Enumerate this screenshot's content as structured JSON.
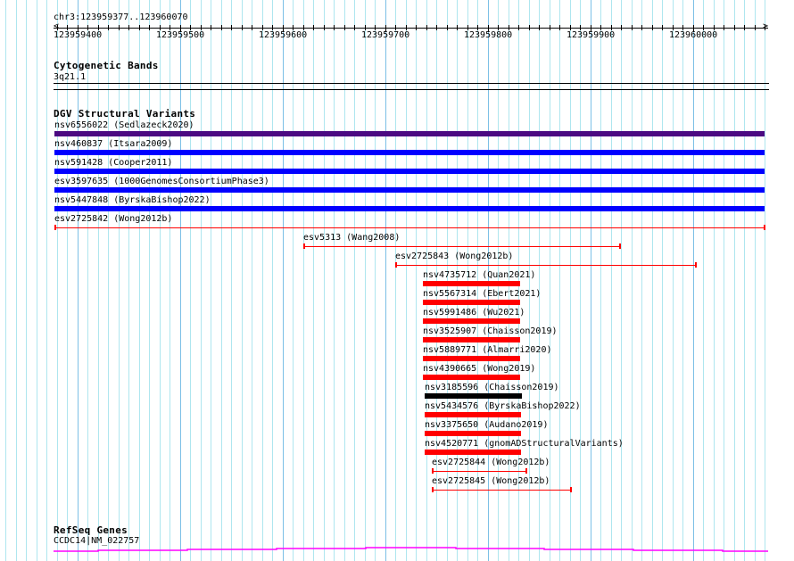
{
  "ruler": {
    "location": "chr3:123959377..123960070",
    "start": 123959377,
    "end": 123960070,
    "tick_labels": [
      "123959400",
      "123959500",
      "123959600",
      "123959700",
      "123959800",
      "123959900",
      "123960000"
    ]
  },
  "cytoband": {
    "title": "Cytogenetic Bands",
    "band": "3q21.1"
  },
  "dgv": {
    "title": "DGV Structural Variants",
    "features": [
      {
        "label": "nsv6556022 (Sedlazeck2020)",
        "start": 123959377,
        "end": 123960070,
        "style": "thick",
        "color": "#4b0a82"
      },
      {
        "label": "nsv460837 (Itsara2009)",
        "start": 123959377,
        "end": 123960070,
        "style": "thick",
        "color": "#0000ff"
      },
      {
        "label": "nsv591428 (Cooper2011)",
        "start": 123959377,
        "end": 123960070,
        "style": "thick",
        "color": "#0000ff"
      },
      {
        "label": "esv3597635 (1000GenomesConsortiumPhase3)",
        "start": 123959377,
        "end": 123960070,
        "style": "thick",
        "color": "#0000ff"
      },
      {
        "label": "nsv5447848 (ByrskaBishop2022)",
        "start": 123959377,
        "end": 123960070,
        "style": "thick",
        "color": "#0000ff"
      },
      {
        "label": "esv2725842 (Wong2012b)",
        "start": 123959377,
        "end": 123960070,
        "style": "line",
        "color": "#ff0000"
      },
      {
        "label": "esv5313 (Wang2008)",
        "start": 123959620,
        "end": 123959929,
        "style": "line",
        "color": "#ff0000"
      },
      {
        "label": "esv2725843 (Wong2012b)",
        "start": 123959710,
        "end": 123960003,
        "style": "line",
        "color": "#ff0000"
      },
      {
        "label": "nsv4735712 (Quan2021)",
        "start": 123959737,
        "end": 123959831,
        "style": "thick",
        "color": "#ff0000"
      },
      {
        "label": "nsv5567314 (Ebert2021)",
        "start": 123959737,
        "end": 123959831,
        "style": "thick",
        "color": "#ff0000"
      },
      {
        "label": "nsv5991486 (Wu2021)",
        "start": 123959737,
        "end": 123959831,
        "style": "thick",
        "color": "#ff0000"
      },
      {
        "label": "nsv3525907 (Chaisson2019)",
        "start": 123959737,
        "end": 123959831,
        "style": "thick",
        "color": "#ff0000"
      },
      {
        "label": "nsv5889771 (Almarri2020)",
        "start": 123959737,
        "end": 123959831,
        "style": "thick",
        "color": "#ff0000"
      },
      {
        "label": "nsv4390665 (Wong2019)",
        "start": 123959737,
        "end": 123959831,
        "style": "thick",
        "color": "#ff0000"
      },
      {
        "label": "nsv3185596 (Chaisson2019)",
        "start": 123959738,
        "end": 123959833,
        "style": "thick",
        "color": "#000000"
      },
      {
        "label": "nsv5434576 (ByrskaBishop2022)",
        "start": 123959738,
        "end": 123959832,
        "style": "thick",
        "color": "#ff0000"
      },
      {
        "label": "nsv3375650 (Audano2019)",
        "start": 123959738,
        "end": 123959832,
        "style": "thick",
        "color": "#ff0000"
      },
      {
        "label": "nsv4520771 (gnomADStructuralVariants)",
        "start": 123959738,
        "end": 123959832,
        "style": "thick",
        "color": "#ff0000"
      },
      {
        "label": "esv2725844 (Wong2012b)",
        "start": 123959745,
        "end": 123959837,
        "style": "line",
        "color": "#ff0000"
      },
      {
        "label": "esv2725845 (Wong2012b)",
        "start": 123959745,
        "end": 123959881,
        "style": "line",
        "color": "#ff0000"
      }
    ]
  },
  "refseq": {
    "title": "RefSeq Genes",
    "gene": "CCDC14|NM_022757",
    "color": "#ff00ff"
  }
}
